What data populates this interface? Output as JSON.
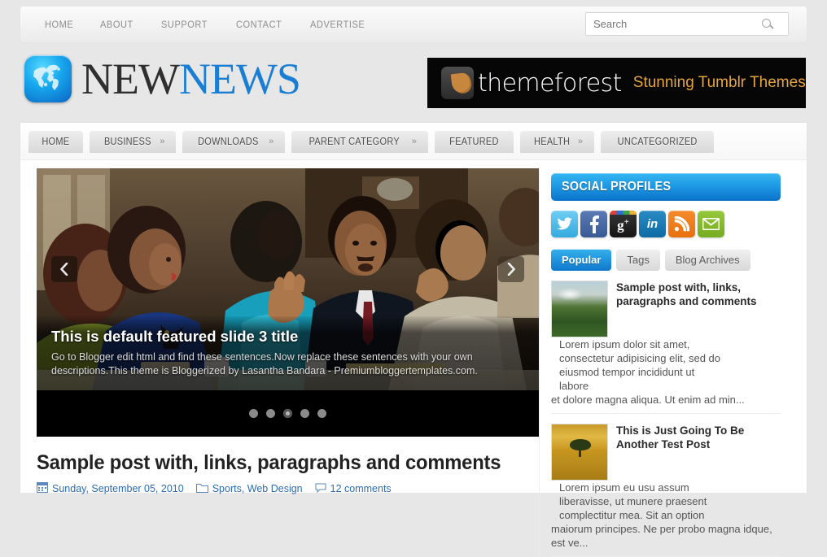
{
  "topnav": {
    "items": [
      "HOME",
      "ABOUT",
      "SUPPORT",
      "CONTACT",
      "ADVERTISE"
    ],
    "search": {
      "value": "",
      "placeholder": "Search",
      "icon": "search-icon"
    }
  },
  "brand": {
    "icon": "globe-icon",
    "name_part1": "NEW",
    "name_part2": "NEWS",
    "color_part1": "#2f2f2f",
    "color_part2": "#1a7fd4"
  },
  "ad": {
    "icon": "themeforest-leaf-icon",
    "brand": "themeforest",
    "tagline": "Stunning Tumblr Themes",
    "background": "#060606",
    "tagline_color": "#e7a53a"
  },
  "catnav": {
    "items": [
      {
        "label": "HOME",
        "has_arrow": false
      },
      {
        "label": "BUSINESS",
        "has_arrow": true,
        "arrow": "»"
      },
      {
        "label": "DOWNLOADS",
        "has_arrow": true,
        "arrow": "»"
      },
      {
        "label": "PARENT CATEGORY",
        "has_arrow": true,
        "arrow": "»"
      },
      {
        "label": "FEATURED",
        "has_arrow": false
      },
      {
        "label": "HEALTH",
        "has_arrow": true,
        "arrow": "»"
      },
      {
        "label": "UNCATEGORIZED",
        "has_arrow": false
      }
    ]
  },
  "slider": {
    "title": "This is default featured slide 3 title",
    "description": "Go to Blogger edit html and find these sentences.Now replace these sentences with your own descriptions.This theme is Bloggerized by Lasantha Bandara - Premiumbloggertemplates.com.",
    "prev_icon": "chevron-left-icon",
    "next_icon": "chevron-right-icon",
    "dots_total": 5,
    "active_dot": 3
  },
  "post": {
    "title": "Sample post with, links, paragraphs and comments",
    "date": "Sunday, September 05, 2010",
    "categories": "Sports, Web Design",
    "comments": "12 comments",
    "date_icon": "calendar-icon",
    "category_icon": "folder-icon",
    "comment_icon": "comment-icon",
    "link_color": "#2e6db4"
  },
  "sidebar": {
    "social_widget_title": "SOCIAL PROFILES",
    "socials": [
      {
        "name": "twitter-icon",
        "glyph": "t"
      },
      {
        "name": "facebook-icon",
        "glyph": "f"
      },
      {
        "name": "googleplus-icon",
        "glyph": "g+"
      },
      {
        "name": "linkedin-icon",
        "glyph": "in"
      },
      {
        "name": "rss-icon",
        "glyph": "rss"
      },
      {
        "name": "email-icon",
        "glyph": "mail"
      }
    ],
    "tabs": [
      {
        "label": "Popular",
        "active": true
      },
      {
        "label": "Tags",
        "active": false
      },
      {
        "label": "Blog Archives",
        "active": false
      }
    ],
    "popular": [
      {
        "title": "Sample post with, links, paragraphs and comments",
        "snippet_inline": "Lorem ipsum dolor sit amet, consectetur adipisicing elit, sed do eiusmod tempor incididunt ut labore",
        "snippet_rest": "et dolore magna aliqua. Ut enim ad min...",
        "thumb": "green-landscape-thumbnail"
      },
      {
        "title": "This is Just Going To Be Another Test Post",
        "snippet_inline": "Lorem ipsum eu usu assum liberavisse, ut munere praesent complectitur mea. Sit an option",
        "snippet_rest": "maiorum principes. Ne per probo magna idque, est ve...",
        "thumb": "gold-field-tree-thumbnail"
      }
    ]
  }
}
